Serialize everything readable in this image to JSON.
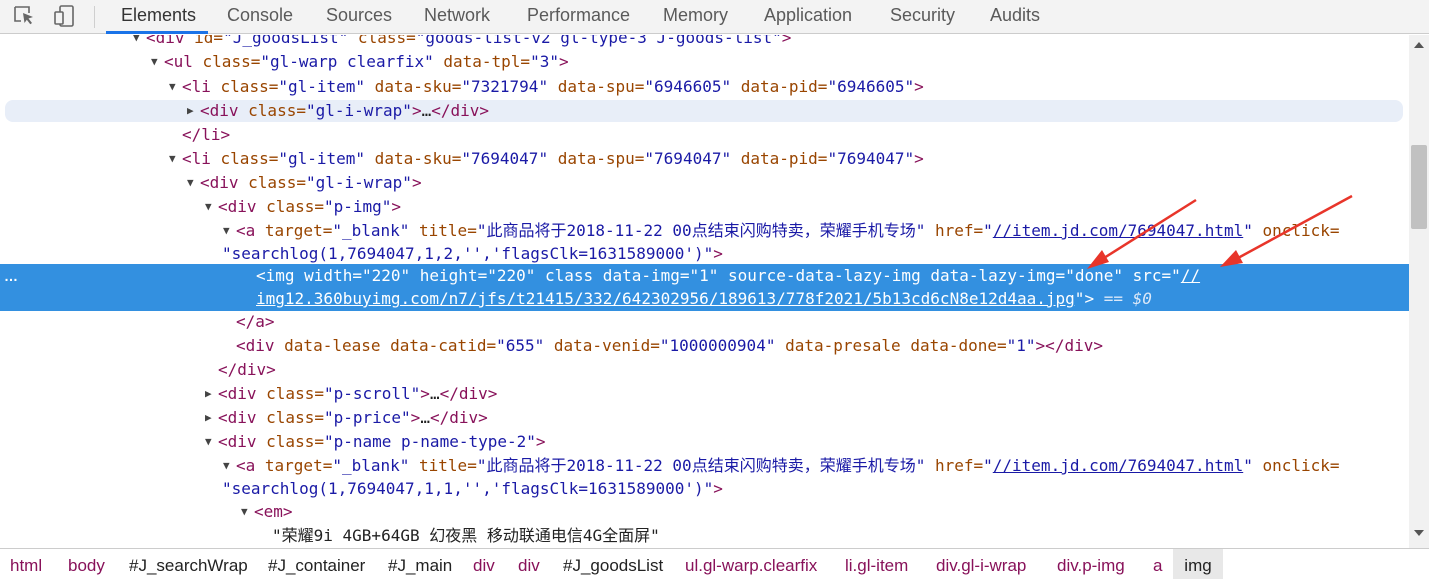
{
  "tabs": [
    "Elements",
    "Console",
    "Sources",
    "Network",
    "Performance",
    "Memory",
    "Application",
    "Security",
    "Audits"
  ],
  "active_tab": "Elements",
  "icons": {
    "inspect": "select-element-icon",
    "device": "device-toolbar-icon"
  },
  "colors": {
    "selection": "#3390e0",
    "tag": "#88125a",
    "attr_name": "#994500",
    "attr_value": "#1a1aa6",
    "annotation_arrow": "#e8352a"
  },
  "dom": {
    "l0": {
      "open": "<div",
      "a1": " id=",
      "v1": "\"J_goodsList\"",
      "a2": " class=",
      "v2": "\"goods-list-v2 gl-type-3 J-goods-list\"",
      "close": ">"
    },
    "l1": {
      "open": "<ul",
      "a1": " class=",
      "v1": "\"gl-warp clearfix\"",
      "a2": " data-tpl=",
      "v2": "\"3\"",
      "close": ">"
    },
    "l2": {
      "open": "<li",
      "a1": " class=",
      "v1": "\"gl-item\"",
      "a2": " data-sku=",
      "v2": "\"7321794\"",
      "a3": " data-spu=",
      "v3": "\"6946605\"",
      "a4": " data-pid=",
      "v4": "\"6946605\"",
      "close": ">"
    },
    "l3": {
      "open": "<div",
      "a1": " class=",
      "v1": "\"gl-i-wrap\"",
      "close": ">",
      "ellipsis": "…",
      "end": "</div>"
    },
    "l4": {
      "end": "</li>"
    },
    "l5": {
      "open": "<li",
      "a1": " class=",
      "v1": "\"gl-item\"",
      "a2": " data-sku=",
      "v2": "\"7694047\"",
      "a3": " data-spu=",
      "v3": "\"7694047\"",
      "a4": " data-pid=",
      "v4": "\"7694047\"",
      "close": ">"
    },
    "l6": {
      "open": "<div",
      "a1": " class=",
      "v1": "\"gl-i-wrap\"",
      "close": ">"
    },
    "l7": {
      "open": "<div",
      "a1": " class=",
      "v1": "\"p-img\"",
      "close": ">"
    },
    "l8": {
      "open": "<a",
      "a1": " target=",
      "v1": "\"_blank\"",
      "a2": " title=",
      "v2": "\"此商品将于2018-11-22 00点结束闪购特卖，荣耀手机专场\"",
      "a3": " href=",
      "q1": "\"",
      "link": "//item.jd.com/7694047.html",
      "q2": "\"",
      "a4": " onclick="
    },
    "l9": {
      "v": "\"searchlog(1,7694047,1,2,'','flagsClk=1631589000')\"",
      "close": ">"
    },
    "l10": {
      "dots": "…",
      "open": "<img",
      "a1": " width=",
      "v1": "\"220\"",
      "a2": " height=",
      "v2": "\"220\"",
      "a3": " class data-img=",
      "v3": "\"1\"",
      "a4": " source-data-lazy-img data-lazy-img=",
      "v4": "\"done\"",
      "a5": " src=",
      "q1": "\"",
      "link1": "//"
    },
    "l11": {
      "link2": "img12.360buyimg.com/n7/jfs/t21415/332/642302956/189613/778f2021/5b13cd6cN8e12d4aa.jpg",
      "q2": "\"",
      "close": ">",
      "eq": " == $0"
    },
    "l12": {
      "end": "</a>"
    },
    "l13": {
      "open": "<div",
      "a1": " data-lease data-catid=",
      "v1": "\"655\"",
      "a2": " data-venid=",
      "v2": "\"1000000904\"",
      "a3": " data-presale data-done=",
      "v3": "\"1\"",
      "close": "></div>"
    },
    "l14": {
      "end": "</div>"
    },
    "l15": {
      "open": "<div",
      "a1": " class=",
      "v1": "\"p-scroll\"",
      "close": ">",
      "ellipsis": "…",
      "end": "</div>"
    },
    "l16": {
      "open": "<div",
      "a1": " class=",
      "v1": "\"p-price\"",
      "close": ">",
      "ellipsis": "…",
      "end": "</div>"
    },
    "l17": {
      "open": "<div",
      "a1": " class=",
      "v1": "\"p-name p-name-type-2\"",
      "close": ">"
    },
    "l18": {
      "open": "<a",
      "a1": " target=",
      "v1": "\"_blank\"",
      "a2": " title=",
      "v2": "\"此商品将于2018-11-22 00点结束闪购特卖，荣耀手机专场\"",
      "a3": " href=",
      "q1": "\"",
      "link": "//item.jd.com/7694047.html",
      "q2": "\"",
      "a4": " onclick="
    },
    "l19": {
      "v": "\"searchlog(1,7694047,1,1,'','flagsClk=1631589000')\"",
      "close": ">"
    },
    "l20": {
      "open": "<em>"
    },
    "l21": {
      "text": "\"荣耀9i 4GB+64GB 幻夜黑 移动联通电信4G全面屏\""
    }
  },
  "breadcrumbs": [
    "html",
    "body",
    "#J_searchWrap",
    "#J_container",
    "#J_main",
    "div",
    "div",
    "#J_goodsList",
    "ul.gl-warp.clearfix",
    "li.gl-item",
    "div.gl-i-wrap",
    "div.p-img",
    "a",
    "img"
  ]
}
